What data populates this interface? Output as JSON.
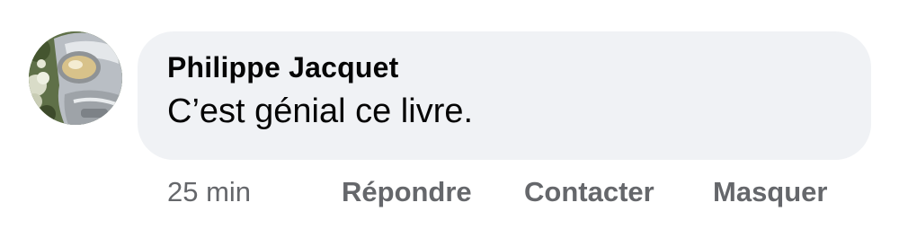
{
  "comment": {
    "author": "Philippe Jacquet",
    "text": "C’est génial ce livre.",
    "avatar_icon": "profile-photo-motorcycle-headlight",
    "bubble_color": "#f0f2f5",
    "text_color": "#050505",
    "meta_color": "#65676b"
  },
  "actions": {
    "time": "25 min",
    "reply_label": "Répondre",
    "contact_label": "Contacter",
    "hide_label": "Masquer"
  }
}
